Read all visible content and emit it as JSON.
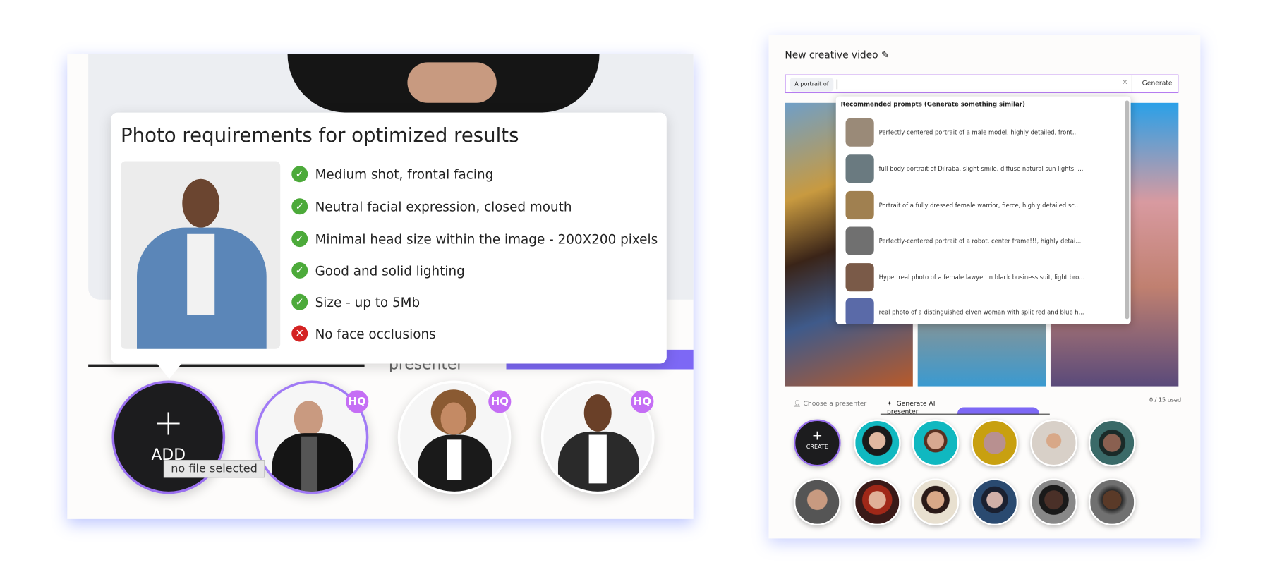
{
  "left_panel": {
    "tooltip": {
      "title": "Photo requirements for optimized results",
      "requirements": [
        {
          "text": "Medium shot, frontal facing",
          "status": "ok"
        },
        {
          "text": "Neutral facial expression, closed mouth",
          "status": "ok"
        },
        {
          "text": "Minimal head size within the image - 200X200 pixels",
          "status": "ok"
        },
        {
          "text": "Good and solid lighting",
          "status": "ok"
        },
        {
          "text": "Size - up to 5Mb",
          "status": "ok"
        },
        {
          "text": "No face occlusions",
          "status": "error"
        }
      ]
    },
    "tab_partial": "presenter",
    "add_label": "ADD",
    "add_icon": "plus-icon",
    "file_tooltip": "no file selected",
    "badge": "HQ",
    "accent": "#7d68f5",
    "badge_color": "#c56ef5"
  },
  "right_panel": {
    "title": "New creative video",
    "edit_icon": "pencil-icon",
    "chip": "A portrait of",
    "clear": "×",
    "generate": "Generate",
    "dropdown_header": "Recommended prompts (Generate something similar)",
    "prompts": [
      "Perfectly-centered portrait of a male model, highly detailed, front...",
      "full body portrait of Dilraba, slight smile, diffuse natural sun lights, ...",
      "Portrait of a fully dressed female warrior, fierce, highly detailed sc...",
      "Perfectly-centered portrait of a robot, center frame!!!, highly detai...",
      "Hyper real photo of a female lawyer in black business suit, light bro...",
      "real photo of a distinguished elven woman with split red and blue h..."
    ],
    "tabs": {
      "choose": "Choose a presenter",
      "generate": "Generate AI presenter"
    },
    "usage": "0 / 15 used",
    "create_label": "CREATE"
  }
}
